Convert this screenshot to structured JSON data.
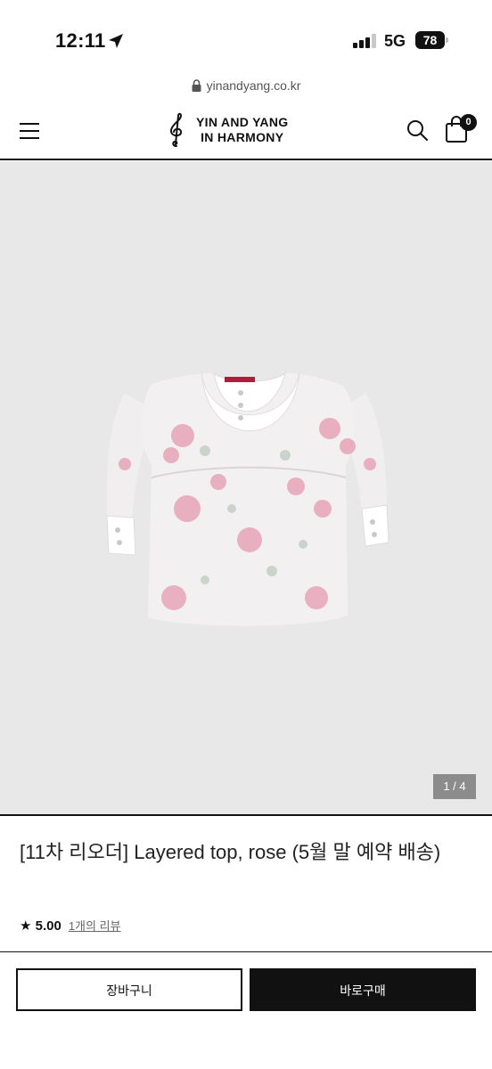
{
  "status_bar": {
    "time": "12:11",
    "network": "5G",
    "battery": "78"
  },
  "browser": {
    "url": "yinandyang.co.kr"
  },
  "header": {
    "logo_line1": "YIN AND YANG",
    "logo_line2": "IN HARMONY",
    "cart_count": "0"
  },
  "gallery": {
    "page_indicator": "1 / 4"
  },
  "product": {
    "title": "[11차 리오더] Layered top, rose (5월 말 예약 배송)",
    "rating": "★ 5.00",
    "review_link": "1개의 리뷰"
  },
  "actions": {
    "cart_label": "장바구니",
    "buy_label": "바로구매"
  },
  "colors": {
    "primary": "#111111",
    "gallery_bg": "#e8e8e8",
    "indicator_bg": "#8c8c8c"
  }
}
